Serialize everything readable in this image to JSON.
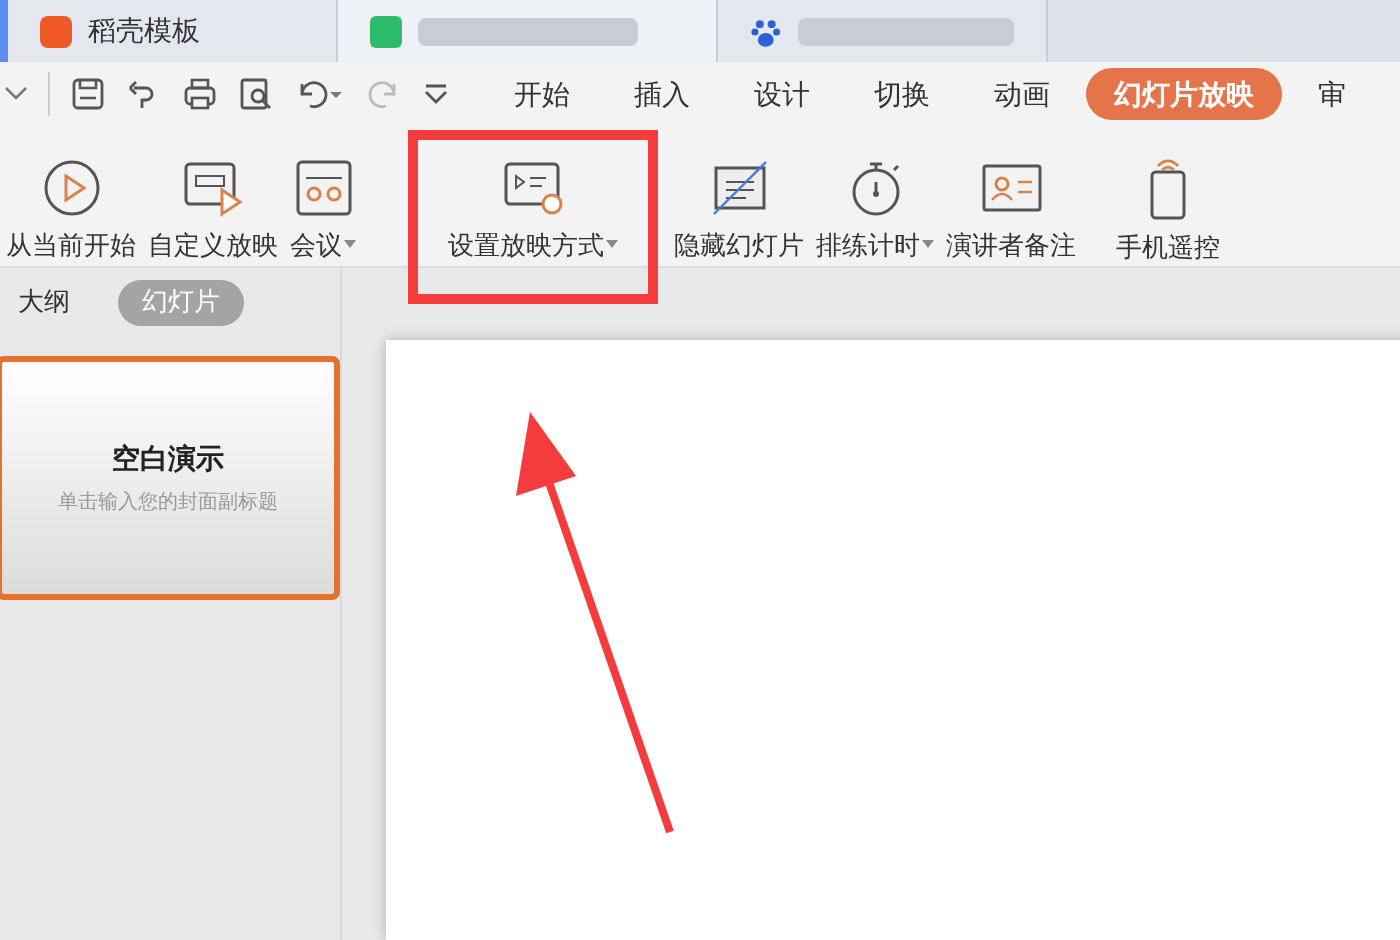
{
  "browser_tabs": [
    {
      "label": "稻壳模板",
      "kind": "docer",
      "selected": false
    },
    {
      "kind": "doc",
      "selected": true
    },
    {
      "kind": "baidu",
      "selected": false
    }
  ],
  "ribbon_tabs": [
    {
      "label": "开始",
      "selected": false
    },
    {
      "label": "插入",
      "selected": false
    },
    {
      "label": "设计",
      "selected": false
    },
    {
      "label": "切换",
      "selected": false
    },
    {
      "label": "动画",
      "selected": false
    },
    {
      "label": "幻灯片放映",
      "selected": true
    },
    {
      "label": "审",
      "selected": false
    }
  ],
  "ribbon_buttons": [
    {
      "label": "从当前开始",
      "kind": "play",
      "dropdown": false,
      "highlighted": false
    },
    {
      "label": "自定义放映",
      "kind": "custom",
      "dropdown": false,
      "highlighted": false
    },
    {
      "label": "会议",
      "kind": "meeting",
      "dropdown": true,
      "highlighted": false
    },
    {
      "label": "设置放映方式",
      "kind": "setup",
      "dropdown": true,
      "highlighted": true
    },
    {
      "label": "隐藏幻灯片",
      "kind": "hide",
      "dropdown": false,
      "highlighted": false
    },
    {
      "label": "排练计时",
      "kind": "timer",
      "dropdown": true,
      "highlighted": false
    },
    {
      "label": "演讲者备注",
      "kind": "notes",
      "dropdown": false,
      "highlighted": false
    },
    {
      "label": "手机遥控",
      "kind": "phone",
      "dropdown": false,
      "highlighted": false
    }
  ],
  "panel_tabs": [
    {
      "label": "大纲",
      "selected": false
    },
    {
      "label": "幻灯片",
      "selected": true
    }
  ],
  "thumbnail": {
    "title": "空白演示",
    "subtitle": "单击输入您的封面副标题",
    "selected": true
  }
}
